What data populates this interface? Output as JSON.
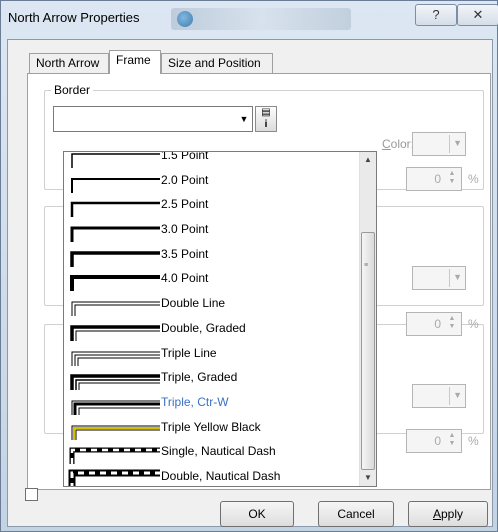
{
  "window": {
    "title": "North Arrow Properties",
    "help_glyph": "?",
    "close_glyph": "✕"
  },
  "tabs": [
    {
      "label": "North Arrow",
      "active": false
    },
    {
      "label": "Frame",
      "active": true
    },
    {
      "label": "Size and Position",
      "active": false
    }
  ],
  "border": {
    "group_label": "Border",
    "color_label": "Color:",
    "gap_value": "0",
    "gap_suffix": "%"
  },
  "background": {
    "gap_value": "0",
    "gap_suffix": "%"
  },
  "shadow": {
    "gap_value": "0",
    "gap_suffix": "%"
  },
  "dropdown": {
    "items": [
      {
        "label": "1.5 Point",
        "style": "line",
        "weight": 1.5
      },
      {
        "label": "2.0 Point",
        "style": "line",
        "weight": 2.0
      },
      {
        "label": "2.5 Point",
        "style": "line",
        "weight": 2.5
      },
      {
        "label": "3.0 Point",
        "style": "line",
        "weight": 3.0
      },
      {
        "label": "3.5 Point",
        "style": "line",
        "weight": 3.5
      },
      {
        "label": "4.0 Point",
        "style": "line",
        "weight": 4.0
      },
      {
        "label": "Double Line",
        "style": "double"
      },
      {
        "label": "Double, Graded",
        "style": "double-graded"
      },
      {
        "label": "Triple Line",
        "style": "triple"
      },
      {
        "label": "Triple, Graded",
        "style": "triple-graded"
      },
      {
        "label": "Triple, Ctr-W",
        "style": "triple-ctrw",
        "highlighted": true
      },
      {
        "label": "Triple Yellow Black",
        "style": "yellow-black"
      },
      {
        "label": "Single, Nautical Dash",
        "style": "nautical-single"
      },
      {
        "label": "Double, Nautical Dash",
        "style": "nautical-double"
      }
    ],
    "highlight_color": "#3a72c4"
  },
  "buttons": {
    "ok": "OK",
    "cancel": "Cancel",
    "apply": "Apply"
  }
}
